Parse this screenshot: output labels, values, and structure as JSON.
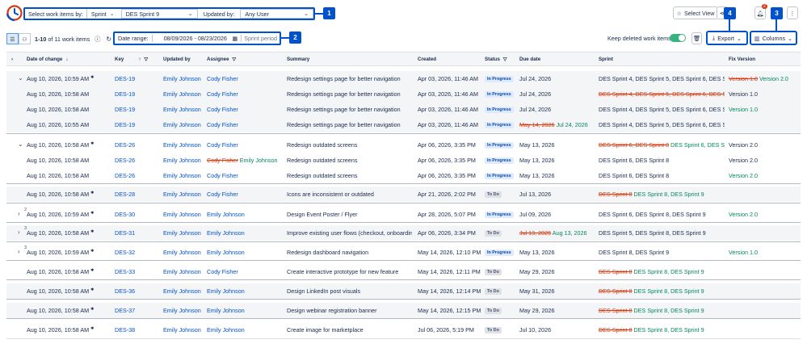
{
  "topbar": {
    "select_label": "Select work items by:",
    "select_by": "Sprint",
    "sprint_value": "DES Sprint 9",
    "updated_by_label": "Updated by:",
    "updated_by_value": "Any User",
    "select_view_label": "Select View",
    "notification_count": "2"
  },
  "toolbar": {
    "count_range": "1-10",
    "count_text": "of 11 work items",
    "date_range_label": "Date range:",
    "date_range_value": "08/09/2026 - 08/23/2026",
    "sprint_period_label": "Sprint period",
    "keep_deleted_label": "Keep deleted work items",
    "export_label": "Export",
    "columns_label": "Columns"
  },
  "callouts": [
    "1",
    "2",
    "3",
    "4"
  ],
  "table": {
    "headers": {
      "date": "Date of change",
      "key": "Key",
      "updated_by": "Updated by",
      "assignee": "Assignee",
      "summary": "Summary",
      "created": "Created",
      "status": "Status",
      "due": "Due date",
      "sprint": "Sprint",
      "fix": "Fix Version"
    },
    "rows": [
      {
        "caret": "⌄",
        "num": "",
        "date": "Aug 10, 2026, 10:59 AM",
        "star": true,
        "key": "DES-19",
        "upd": "Emily Johnson",
        "assignee_old": "",
        "assignee": "Cody Fisher",
        "summary": "Redesign settings page for better navigation",
        "created": "Apr 03, 2026, 11:46 AM",
        "status": "In Progress",
        "due_old": "",
        "due": "Jul 24, 2026",
        "sprint_old": "",
        "sprint": "DES Sprint 4, DES Sprint 5, DES Sprint 6, DES Sprint 8",
        "fix_old": "Version 1.0",
        "fix": "Version 2.0",
        "fix_plain": ""
      },
      {
        "caret": "",
        "num": "",
        "date": "Aug 10, 2026, 10:58 AM",
        "star": false,
        "key": "DES-19",
        "upd": "Emily Johnson",
        "assignee_old": "",
        "assignee": "Cody Fisher",
        "summary": "Redesign settings page for better navigation",
        "created": "Apr 03, 2026, 11:46 AM",
        "status": "In Progress",
        "due_old": "",
        "due": "Jul 24, 2026",
        "sprint_old": "DES Sprint 4, DES Sprint 5, DES Sprint 6, DES Sprint 8",
        "sprint": "",
        "fix_old": "",
        "fix": "",
        "fix_plain": "Version 1.0"
      },
      {
        "caret": "",
        "num": "",
        "date": "Aug 10, 2026, 10:58 AM",
        "star": false,
        "key": "DES-19",
        "upd": "Emily Johnson",
        "assignee_old": "",
        "assignee": "Cody Fisher",
        "summary": "Redesign settings page for better navigation",
        "created": "Apr 03, 2026, 11:46 AM",
        "status": "In Progress",
        "due_old": "",
        "due": "Jul 24, 2026",
        "sprint_old": "",
        "sprint": "DES Sprint 4, DES Sprint 5, DES Sprint 6, DES Sprint 8",
        "fix_old": "",
        "fix": "Version 1.0",
        "fix_plain": ""
      },
      {
        "caret": "",
        "num": "",
        "date": "Aug 10, 2026, 10:55 AM",
        "star": false,
        "key": "DES-19",
        "upd": "Emily Johnson",
        "assignee_old": "",
        "assignee": "Cody Fisher",
        "summary": "Redesign settings page for better navigation",
        "created": "Apr 03, 2026, 11:46 AM",
        "status": "In Progress",
        "due_old": "May 14, 2026",
        "due": "Jul 24, 2026",
        "sprint_old": "",
        "sprint": "DES Sprint 4, DES Sprint 5, DES Sprint 6, DES Sprint 8",
        "fix_old": "",
        "fix": "",
        "fix_plain": ""
      },
      {
        "caret": "⌄",
        "num": "",
        "date": "Aug 10, 2026, 10:58 AM",
        "star": true,
        "key": "DES-26",
        "upd": "Emily Johnson",
        "assignee_old": "",
        "assignee": "Cody Fisher",
        "summary": "Redesign outdated screens",
        "created": "Apr 06, 2026, 3:35 PM",
        "status": "In Progress",
        "due_old": "",
        "due": "May 13, 2026",
        "sprint_old": "DES Sprint 6, DES Sprint 8",
        "sprint": "DES Sprint 6, DES Sprint 8, DES Sp",
        "fix_old": "",
        "fix": "",
        "fix_plain": "Version 2.0"
      },
      {
        "caret": "",
        "num": "",
        "date": "Aug 10, 2026, 10:58 AM",
        "star": false,
        "key": "DES-26",
        "upd": "Emily Johnson",
        "assignee_old": "Cody Fisher",
        "assignee": "Emily Johnson",
        "summary": "Redesign outdated screens",
        "created": "Apr 06, 2026, 3:35 PM",
        "status": "In Progress",
        "due_old": "",
        "due": "May 13, 2026",
        "sprint_old": "",
        "sprint": "DES Sprint 6, DES Sprint 8",
        "fix_old": "",
        "fix": "",
        "fix_plain": "Version 2.0"
      },
      {
        "caret": "",
        "num": "",
        "date": "Aug 10, 2026, 10:58 AM",
        "star": false,
        "key": "DES-26",
        "upd": "Emily Johnson",
        "assignee_old": "",
        "assignee": "Cody Fisher",
        "summary": "Redesign outdated screens",
        "created": "Apr 06, 2026, 3:35 PM",
        "status": "In Progress",
        "due_old": "",
        "due": "May 13, 2026",
        "sprint_old": "",
        "sprint": "DES Sprint 6, DES Sprint 8",
        "fix_old": "",
        "fix": "Version 2.0",
        "fix_plain": ""
      },
      {
        "caret": "",
        "num": "",
        "date": "Aug 10, 2026, 10:58 AM",
        "star": true,
        "key": "DES-28",
        "upd": "Emily Johnson",
        "assignee_old": "",
        "assignee": "Cody Fisher",
        "summary": "Icons are inconsistent or outdated",
        "created": "Apr 21, 2026, 2:02 PM",
        "status": "To Do",
        "due_old": "",
        "due": "Jul 13, 2026",
        "sprint_old": "DES Sprint 8",
        "sprint": "DES Sprint 8, DES Sprint 9",
        "fix_old": "",
        "fix": "",
        "fix_plain": ""
      },
      {
        "caret": "›",
        "num": "2",
        "date": "Aug 10, 2026, 10:59 AM",
        "star": true,
        "key": "DES-30",
        "upd": "Emily Johnson",
        "assignee_old": "",
        "assignee": "Emily Johnson",
        "summary": "Design Event Poster / Flyer",
        "created": "Apr 28, 2026, 5:07 PM",
        "status": "In Progress",
        "due_old": "",
        "due": "Jul 09, 2026",
        "sprint_old": "",
        "sprint": "DES Sprint 6, DES Sprint 8, DES Sprint 9",
        "fix_old": "",
        "fix": "Version 2.0",
        "fix_plain": ""
      },
      {
        "caret": "›",
        "num": "3",
        "date": "Aug 10, 2026, 10:58 AM",
        "star": true,
        "key": "DES-31",
        "upd": "Emily Johnson",
        "assignee_old": "",
        "assignee": "Emily Johnson",
        "summary": "Improve existing user flows (checkout, onboardin...",
        "created": "Apr 06, 2026, 3:34 PM",
        "status": "To Do",
        "due_old": "Jul 13, 2026",
        "due": "Aug 13, 2026",
        "sprint_old": "",
        "sprint": "DES Sprint 5, DES Sprint 8, DES Sprint 9",
        "fix_old": "",
        "fix": "",
        "fix_plain": ""
      },
      {
        "caret": "›",
        "num": "3",
        "date": "Aug 10, 2026, 10:59 AM",
        "star": true,
        "key": "DES-32",
        "upd": "Emily Johnson",
        "assignee_old": "",
        "assignee": "Emily Johnson",
        "summary": "Redesign dashboard navigation",
        "created": "May 14, 2026, 12:10 PM",
        "status": "In Progress",
        "due_old": "",
        "due": "May 13, 2026",
        "sprint_old": "",
        "sprint": "DES Sprint 8, DES Sprint 9",
        "fix_old": "",
        "fix": "Version 1.0",
        "fix_plain": ""
      },
      {
        "caret": "",
        "num": "",
        "date": "Aug 10, 2026, 10:58 AM",
        "star": true,
        "key": "DES-33",
        "upd": "Emily Johnson",
        "assignee_old": "",
        "assignee": "Cody Fisher",
        "summary": "Create interactive prototype for new feature",
        "created": "May 14, 2026, 12:11 PM",
        "status": "To Do",
        "due_old": "",
        "due": "May 29, 2026",
        "sprint_old": "DES Sprint 8",
        "sprint": "DES Sprint 8, DES Sprint 9",
        "fix_old": "",
        "fix": "",
        "fix_plain": ""
      },
      {
        "caret": "",
        "num": "",
        "date": "Aug 10, 2026, 10:58 AM",
        "star": true,
        "key": "DES-36",
        "upd": "Emily Johnson",
        "assignee_old": "",
        "assignee": "Emily Johnson",
        "summary": "Design LinkedIn post visuals",
        "created": "May 14, 2026, 12:14 PM",
        "status": "To Do",
        "due_old": "",
        "due": "May 31, 2026",
        "sprint_old": "DES Sprint 8",
        "sprint": "DES Sprint 8, DES Sprint 9",
        "fix_old": "",
        "fix": "",
        "fix_plain": ""
      },
      {
        "caret": "",
        "num": "",
        "date": "Aug 10, 2026, 10:58 AM",
        "star": true,
        "key": "DES-37",
        "upd": "Emily Johnson",
        "assignee_old": "",
        "assignee": "Emily Johnson",
        "summary": "Design webinar registration banner",
        "created": "May 14, 2026, 12:15 PM",
        "status": "To Do",
        "due_old": "",
        "due": "May 29, 2026",
        "sprint_old": "DES Sprint 8",
        "sprint": "DES Sprint 8, DES Sprint 9",
        "fix_old": "",
        "fix": "",
        "fix_plain": ""
      },
      {
        "caret": "",
        "num": "",
        "date": "Aug 10, 2026, 10:58 AM",
        "star": true,
        "key": "DES-38",
        "upd": "Emily Johnson",
        "assignee_old": "",
        "assignee": "Emily Johnson",
        "summary": "Create image for marketplace",
        "created": "Jul 06, 2026, 5:19 PM",
        "status": "To Do",
        "due_old": "",
        "due": "Jul 10, 2026",
        "sprint_old": "DES Sprint 8",
        "sprint": "DES Sprint 8, DES Sprint 9",
        "fix_old": "",
        "fix": "",
        "fix_plain": ""
      }
    ]
  }
}
